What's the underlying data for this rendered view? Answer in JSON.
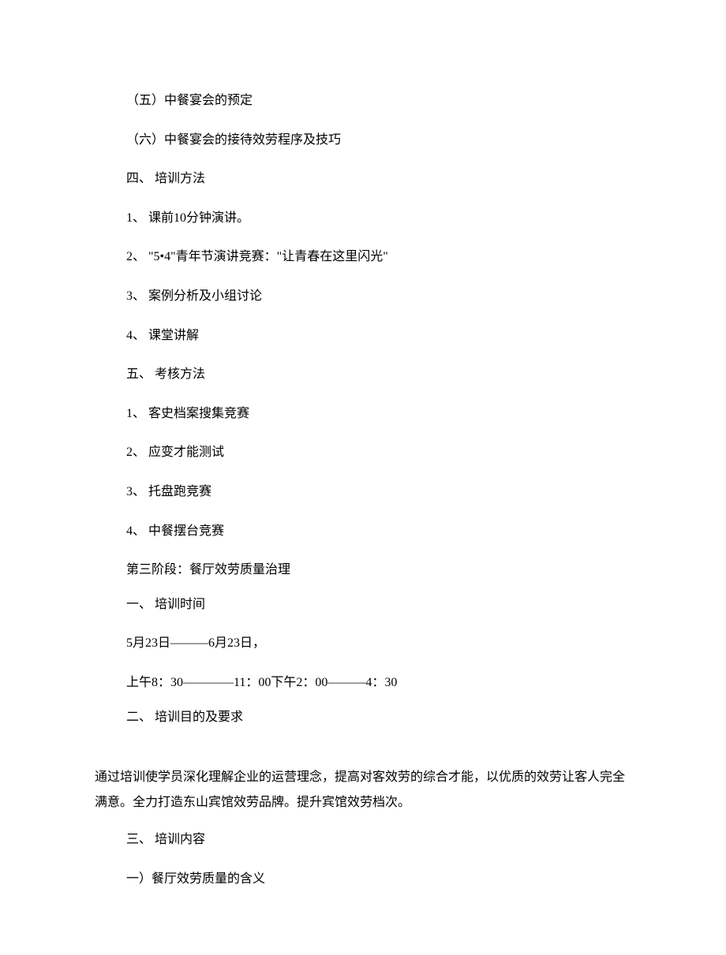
{
  "lines": [
    {
      "cls": "line indent-1",
      "text": "（五）中餐宴会的预定"
    },
    {
      "cls": "line indent-1",
      "text": "（六）中餐宴会的接待效劳程序及技巧"
    },
    {
      "cls": "line indent-1",
      "text": "四、 培训方法"
    },
    {
      "cls": "line indent-1",
      "text": "1、 课前10分钟演讲。"
    },
    {
      "cls": "line indent-1",
      "text": "2、 \"5•4\"青年节演讲竞赛：\"让青春在这里闪光\""
    },
    {
      "cls": "line indent-1",
      "text": "3、 案例分析及小组讨论"
    },
    {
      "cls": "line indent-1",
      "text": "4、 课堂讲解"
    },
    {
      "cls": "line indent-1",
      "text": "五、 考核方法"
    },
    {
      "cls": "line indent-1",
      "text": "1、 客史档案搜集竞赛"
    },
    {
      "cls": "line indent-1",
      "text": "2、 应变才能测试"
    },
    {
      "cls": "line indent-1",
      "text": "3、 托盘跑竞赛"
    },
    {
      "cls": "line indent-1",
      "text": "4、 中餐摆台竞赛"
    },
    {
      "cls": "line indent-1",
      "text": "第三阶段：餐厅效劳质量治理"
    },
    {
      "cls": "line indent-1",
      "text": "一、 培训时间"
    },
    {
      "cls": "line indent-1",
      "text": "5月23日———6月23日，"
    },
    {
      "cls": "line indent-1",
      "text": "上午8：30————11：00下午2：00———4：30"
    },
    {
      "cls": "line indent-1",
      "text": "二、 培训目的及要求"
    }
  ],
  "paragraph": "通过培训使学员深化理解企业的运营理念，提高对客效劳的综合才能，以优质的效劳让客人完全满意。全力打造东山宾馆效劳品牌。提升宾馆效劳档次。",
  "tail": [
    {
      "cls": "line indent-1",
      "text": "三、 培训内容"
    },
    {
      "cls": "line indent-1",
      "text": "一）餐厅效劳质量的含义"
    }
  ]
}
